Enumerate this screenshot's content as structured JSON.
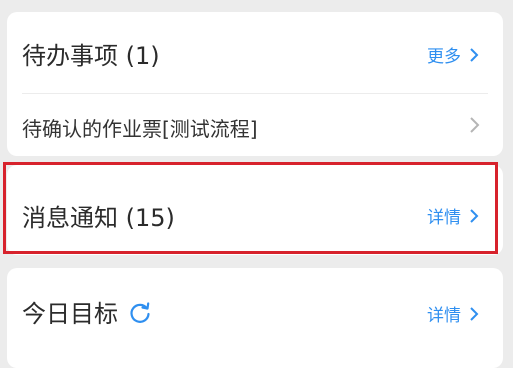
{
  "todo": {
    "title": "待办事项 (1)",
    "more_label": "更多",
    "items": [
      {
        "label": "待确认的作业票[测试流程]"
      }
    ]
  },
  "messages": {
    "title": "消息通知 (15)",
    "detail_label": "详情"
  },
  "goals": {
    "title": "今日目标",
    "detail_label": "详情"
  },
  "colors": {
    "accent": "#2f8ff0",
    "highlight": "#d7222c",
    "background": "#ececec"
  },
  "icons": {
    "more_chevron": "chevron-right-icon",
    "item_chevron": "chevron-right-icon",
    "refresh": "refresh-icon"
  }
}
